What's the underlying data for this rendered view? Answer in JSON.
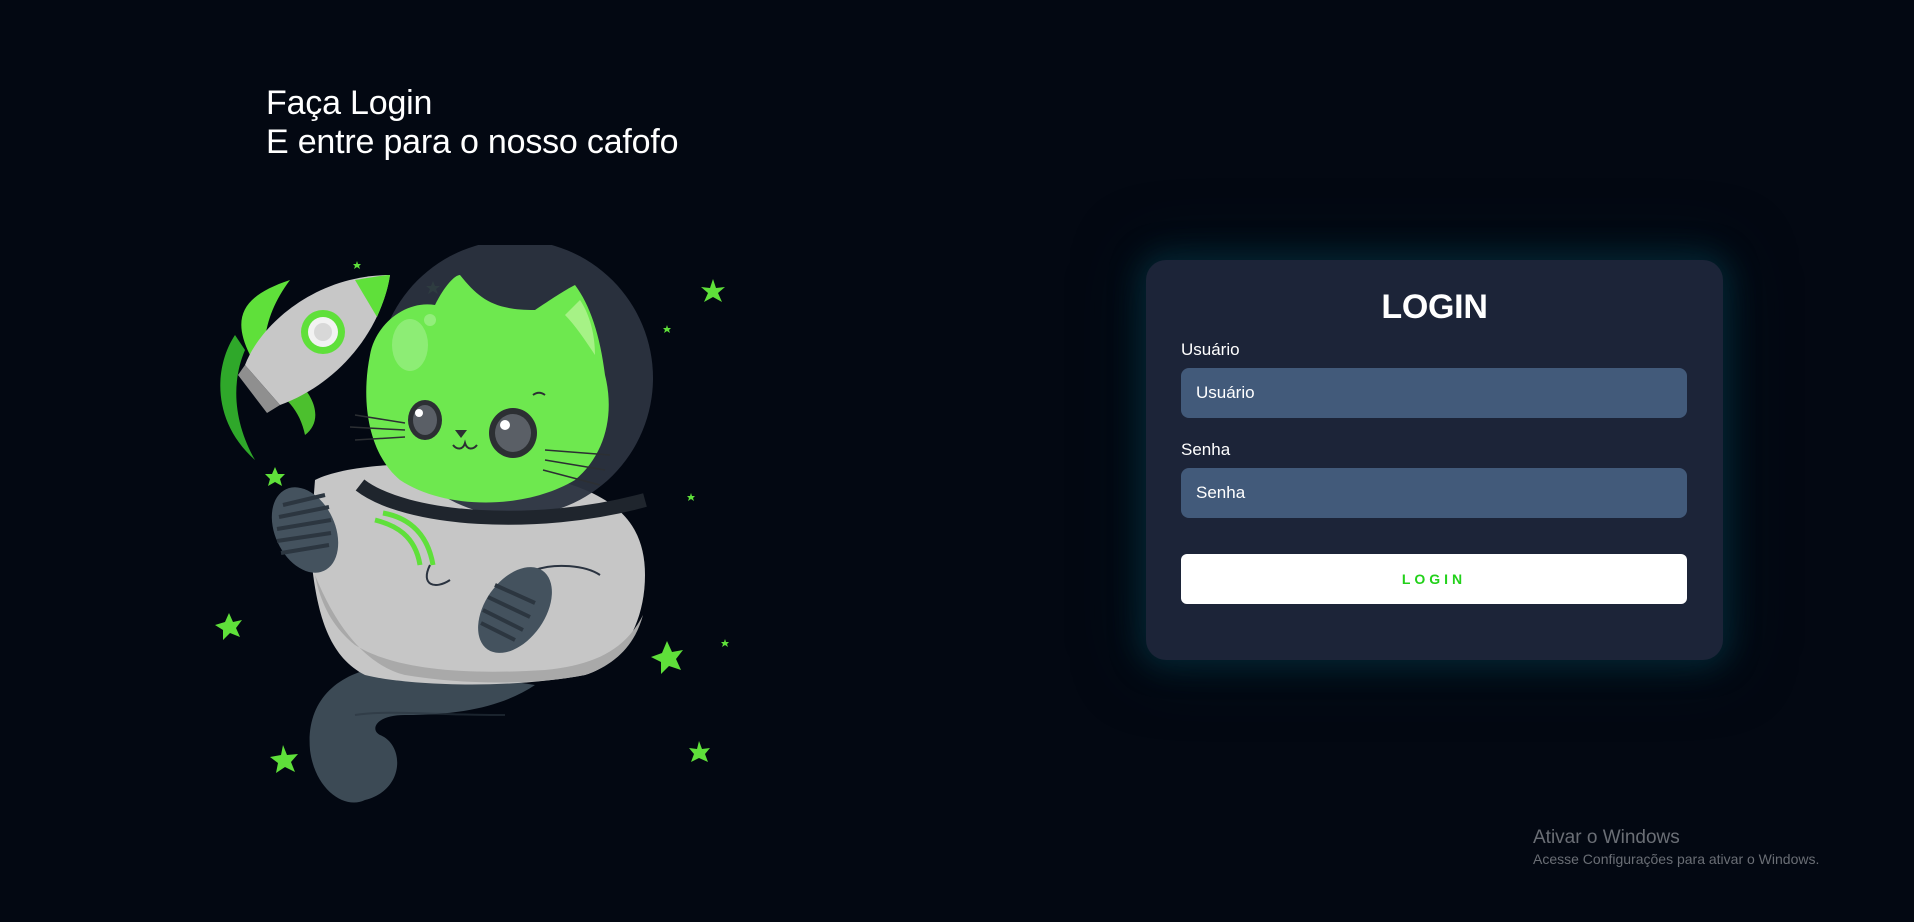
{
  "heading": {
    "line1": "Faça Login",
    "line2": "E entre para o nosso cafofo"
  },
  "illustration": {
    "icon": "astronaut-cat-with-rocket-illustration",
    "accent_color": "#6ee84f"
  },
  "login_card": {
    "title": "LOGIN",
    "username": {
      "label": "Usuário",
      "placeholder": "Usuário",
      "value": ""
    },
    "password": {
      "label": "Senha",
      "placeholder": "Senha",
      "value": ""
    },
    "submit_label": "LOGIN",
    "submit_text_color": "#22d11a",
    "card_color": "#1c2438",
    "input_color": "#425a7a"
  },
  "windows_watermark": {
    "title": "Ativar o Windows",
    "subtitle": "Acesse Configurações para ativar o Windows."
  },
  "colors": {
    "background": "#030812"
  }
}
